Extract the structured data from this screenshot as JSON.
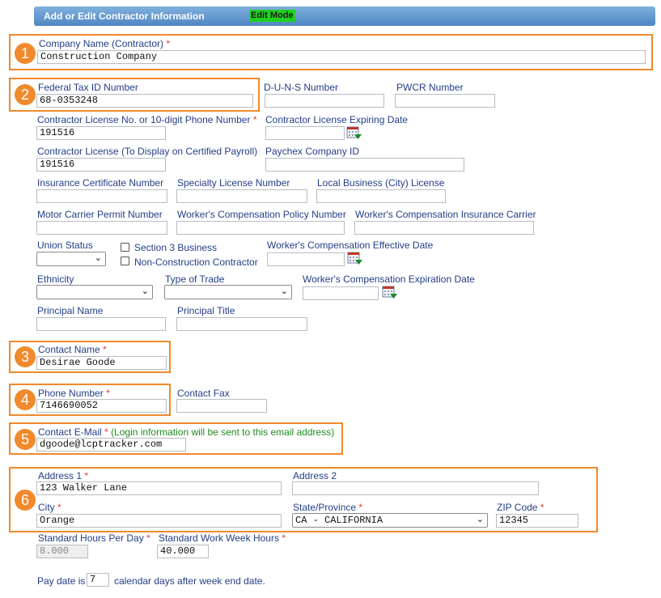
{
  "header": {
    "title": "Add or Edit Contractor Information",
    "mode": "Edit Mode"
  },
  "callouts": [
    "1",
    "2",
    "3",
    "4",
    "5",
    "6"
  ],
  "req_mark": "*",
  "fields": {
    "company_name": {
      "label": "Company Name (Contractor)",
      "value": "Construction Company"
    },
    "federal_tax_id": {
      "label": "Federal Tax ID Number",
      "value": "68-0353248"
    },
    "duns": {
      "label": "D-U-N-S Number",
      "value": ""
    },
    "pwcr": {
      "label": "PWCR Number",
      "value": ""
    },
    "contractor_license": {
      "label": "Contractor License No. or 10-digit Phone Number",
      "value": "191516"
    },
    "license_expiring": {
      "label": "Contractor License Expiring Date",
      "value": ""
    },
    "license_display": {
      "label": "Contractor License (To Display on Certified Payroll)",
      "value": "191516"
    },
    "paychex_id": {
      "label": "Paychex Company ID",
      "value": ""
    },
    "insurance_cert": {
      "label": "Insurance Certificate Number",
      "value": ""
    },
    "specialty_license": {
      "label": "Specialty License Number",
      "value": ""
    },
    "local_business_license": {
      "label": "Local Business (City) License",
      "value": ""
    },
    "motor_carrier": {
      "label": "Motor Carrier Permit Number",
      "value": ""
    },
    "wc_policy": {
      "label": "Worker's Compensation Policy Number",
      "value": ""
    },
    "wc_carrier": {
      "label": "Worker's Compensation Insurance Carrier",
      "value": ""
    },
    "union_status": {
      "label": "Union Status",
      "value": ""
    },
    "section3": {
      "label": "Section 3 Business"
    },
    "non_construction": {
      "label": "Non-Construction Contractor"
    },
    "wc_effective": {
      "label": "Worker's Compensation Effective Date",
      "value": ""
    },
    "ethnicity": {
      "label": "Ethnicity",
      "value": ""
    },
    "type_of_trade": {
      "label": "Type of Trade",
      "value": ""
    },
    "wc_expiration": {
      "label": "Worker's Compensation Expiration Date",
      "value": ""
    },
    "principal_name": {
      "label": "Principal Name",
      "value": ""
    },
    "principal_title": {
      "label": "Principal Title",
      "value": ""
    },
    "contact_name": {
      "label": "Contact Name",
      "value": "Desirae Goode"
    },
    "phone": {
      "label": "Phone Number",
      "value": "7146690052"
    },
    "contact_fax": {
      "label": "Contact Fax",
      "value": ""
    },
    "contact_email": {
      "label": "Contact E-Mail",
      "note": "(Login information will be sent to this email address)",
      "value": "dgoode@lcptracker.com"
    },
    "address1": {
      "label": "Address 1",
      "value": "123 Walker Lane"
    },
    "address2": {
      "label": "Address 2",
      "value": ""
    },
    "city": {
      "label": "City",
      "value": "Orange"
    },
    "state": {
      "label": "State/Province",
      "value": "CA - CALIFORNIA"
    },
    "zip": {
      "label": "ZIP Code",
      "value": "12345"
    },
    "std_hours_day": {
      "label": "Standard Hours Per Day",
      "value": "8.000"
    },
    "std_hours_week": {
      "label": "Standard Work Week Hours",
      "value": "40.000"
    }
  },
  "pay_date": {
    "prefix": "Pay date is",
    "value": "7",
    "suffix": "calendar days after week end date."
  },
  "icons": {
    "dropdown": "chevron-down-icon",
    "calendar": "calendar-icon"
  },
  "colors": {
    "highlight": "#f08a2c",
    "header": "#5b8fc8",
    "edit_mode": "#1fd11f",
    "required": "#e5393b",
    "label": "#233e86"
  }
}
